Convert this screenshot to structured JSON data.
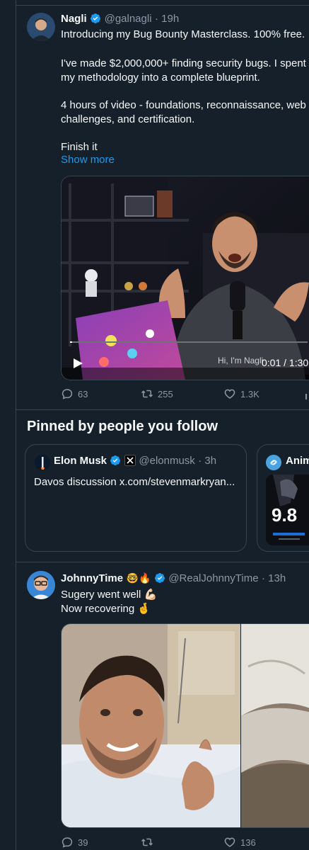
{
  "tweet1": {
    "name": "Nagli",
    "handle": "@galnagli",
    "time": "· 19h",
    "lines": [
      "Introducing my Bug Bounty Masterclass. 100% free.",
      "I've made $2,000,000+ finding security bugs. I spent",
      "my methodology into a complete blueprint.",
      "4 hours of video - foundations, reconnaissance, web",
      "challenges, and certification.",
      "Finish it"
    ],
    "show_more": "Show more",
    "video_caption": "Hi, I'm Nagli",
    "video_time": "0:01 / 1:30",
    "video_progress": 0.01,
    "replies": "63",
    "reposts": "255",
    "likes": "1.3K"
  },
  "pinned": {
    "heading": "Pinned by people you follow",
    "card1": {
      "name": "Elon Musk",
      "handle": "@elonmusk",
      "time": "· 3h",
      "text": "Davos discussion x.com/stevenmarkryan..."
    },
    "card2": {
      "name": "Anim",
      "score": "9.8"
    }
  },
  "tweet2": {
    "name": "JohnnyTime",
    "emojis": "🤓🔥",
    "handle": "@RealJohnnyTime",
    "time": "· 13h",
    "line1": "Sugery went well 💪🏻",
    "line2": "Now recovering 🤞",
    "replies": "39",
    "likes": "136"
  },
  "colors": {
    "background": "#15202b",
    "accent": "#1d9bf0",
    "muted": "#8b98a5",
    "border": "#38444d"
  },
  "icons": [
    "verified-icon",
    "reply-icon",
    "repost-icon",
    "like-icon",
    "play-icon",
    "x-logo-icon",
    "anime-logo-icon"
  ]
}
